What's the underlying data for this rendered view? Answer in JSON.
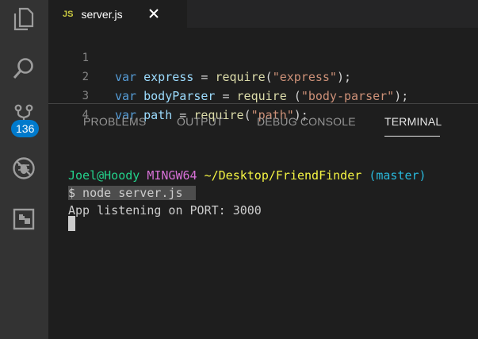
{
  "activity_bar": {
    "items": [
      {
        "name": "explorer",
        "icon": "files-icon"
      },
      {
        "name": "search",
        "icon": "search-icon"
      },
      {
        "name": "source-control",
        "icon": "source-control-icon"
      },
      {
        "name": "debug",
        "icon": "no-bug-icon"
      },
      {
        "name": "extensions",
        "icon": "extensions-icon"
      }
    ],
    "scm_badge": "136"
  },
  "tab": {
    "icon_label": "JS",
    "title": "server.js",
    "close_icon": "close-icon"
  },
  "editor": {
    "lines": [
      {
        "number": "1",
        "keyword": "var",
        "name": "express",
        "op": " = ",
        "call": "require",
        "pre": "(",
        "arg": "\"express\"",
        "post": ");"
      },
      {
        "number": "2",
        "keyword": "var",
        "name": "bodyParser",
        "op": " = ",
        "call": "require",
        "pre": " (",
        "arg": "\"body-parser\"",
        "post": ");"
      },
      {
        "number": "3",
        "keyword": "var",
        "name": "path",
        "op": " = ",
        "call": "require",
        "pre": "(",
        "arg": "\"path\"",
        "post": ");"
      },
      {
        "number": "4"
      }
    ]
  },
  "panel": {
    "tabs": [
      {
        "label": "PROBLEMS",
        "active": false
      },
      {
        "label": "OUTPUT",
        "active": false
      },
      {
        "label": "DEBUG CONSOLE",
        "active": false
      },
      {
        "label": "TERMINAL",
        "active": true
      }
    ]
  },
  "terminal": {
    "prompt": {
      "user_host": "Joel@Hoody",
      "system": "MINGW64",
      "path": "~/Desktop/FriendFinder",
      "branch": "(master)"
    },
    "command": "$ node server.js",
    "output": "App listening on PORT: 3000"
  },
  "colors": {
    "accent": "#007acc",
    "activity_bar": "#333333",
    "editor_bg": "#1e1e1e"
  }
}
